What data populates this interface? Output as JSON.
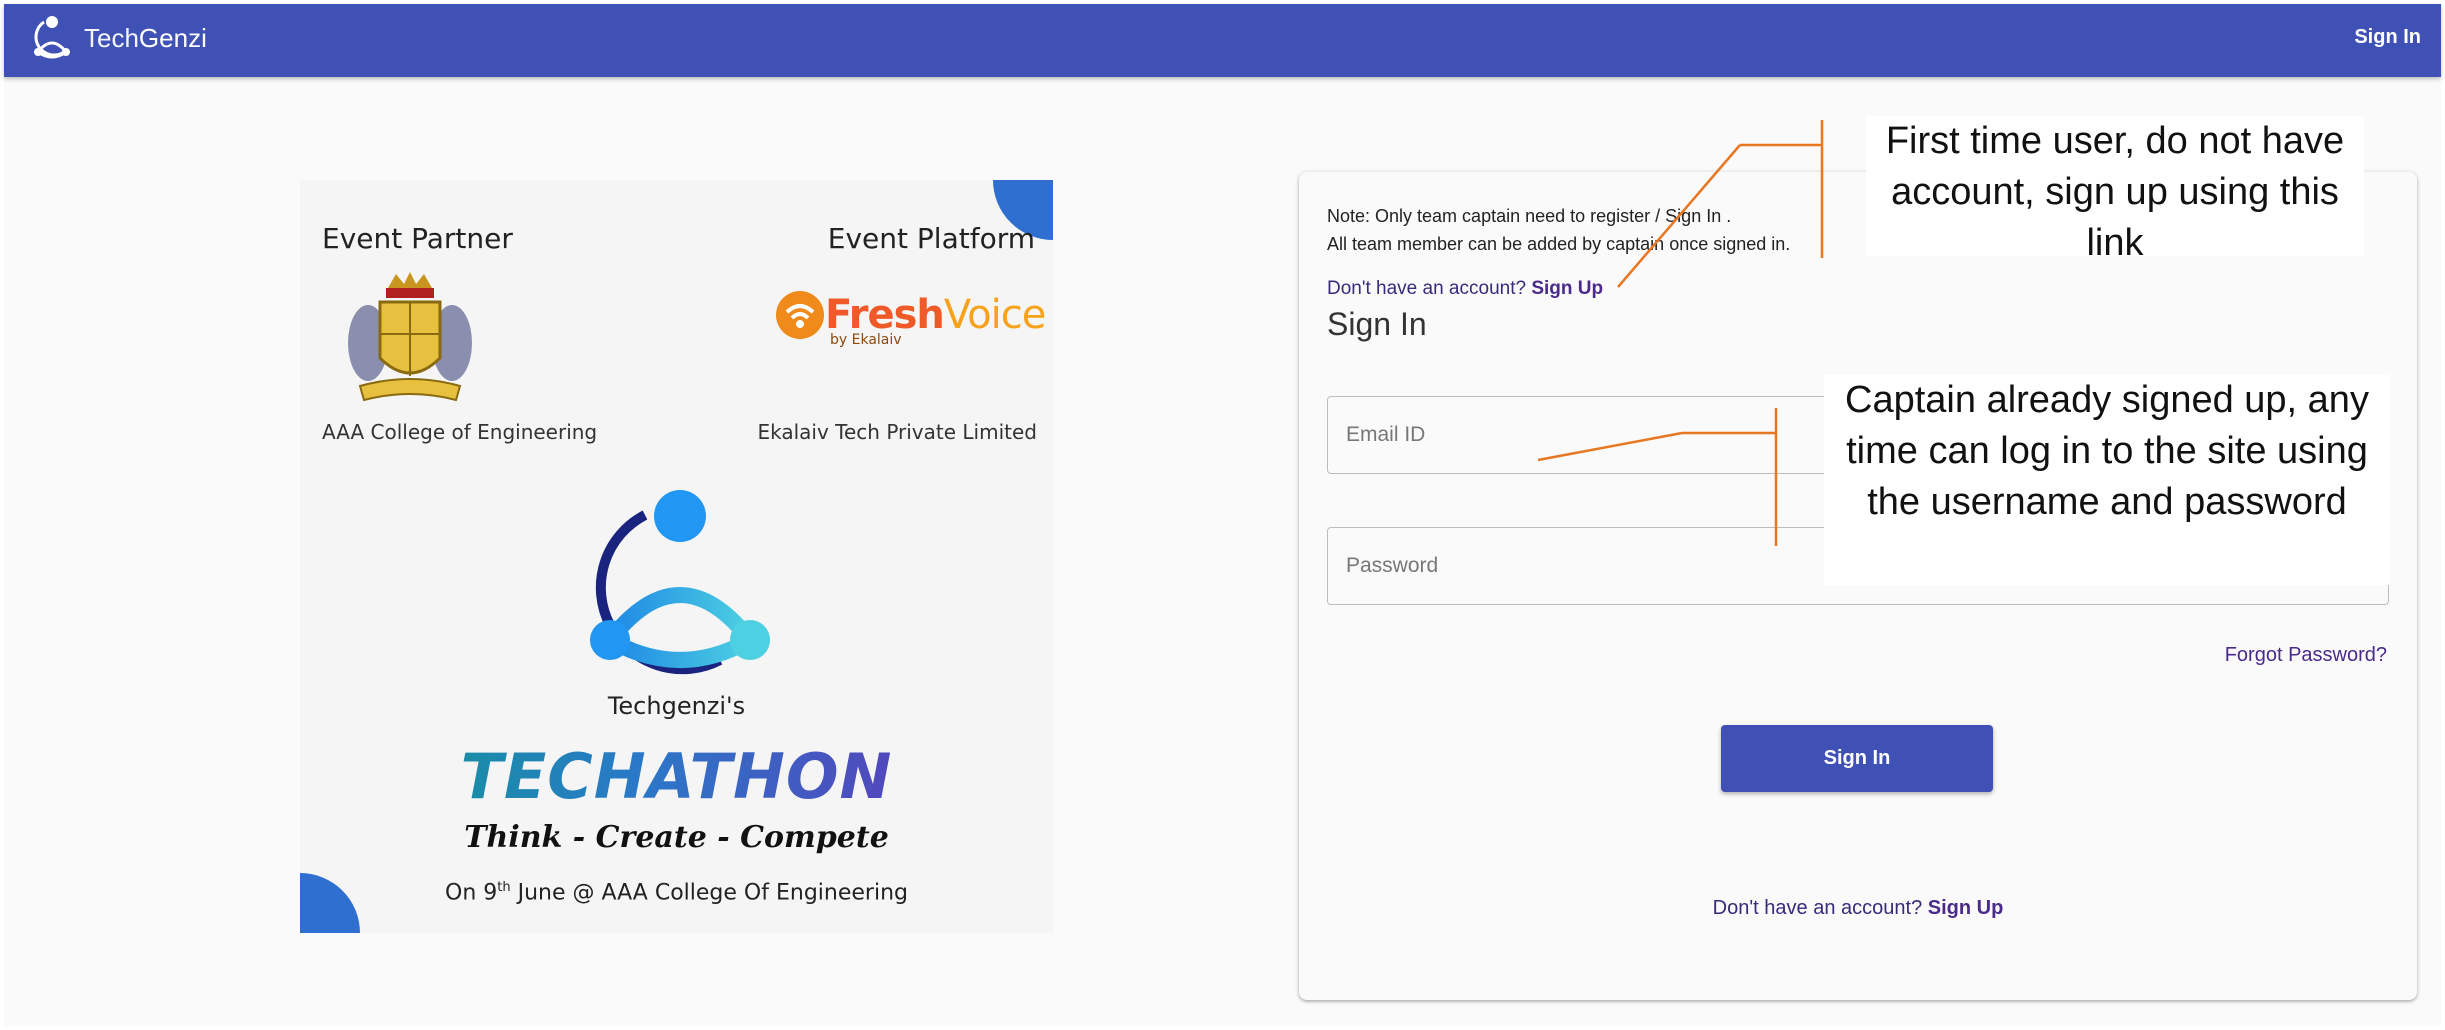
{
  "header": {
    "brand_tech": "Tech",
    "brand_genzi": "Genzi",
    "signin_label": "Sign In",
    "color": "#3f51b5"
  },
  "poster": {
    "event_partner": "Event Partner",
    "event_platform": "Event Platform",
    "partner_name": "AAA College of Engineering",
    "platform_name": "Ekalaiv Tech Private Limited",
    "fv_fresh": "Fresh",
    "fv_voice": "Voice",
    "fv_by": "by Ekalaiv",
    "techgenzi": "Techgenzi's",
    "techathon": "TECHATHON",
    "tagline": "Think - Create - Compete",
    "date_on": "On 9",
    "date_sup": "th",
    "date_rest": " June @ AAA College Of Engineering"
  },
  "form": {
    "note_line1": "Note: Only team captain need to register / Sign In .",
    "note_line2": "All team member can be added by captain once signed in.",
    "no_account": "Don't have an account?",
    "signup_link": "Sign Up",
    "title": "Sign In",
    "email_placeholder": "Email ID",
    "password_placeholder": "Password",
    "forgot": "Forgot Password?",
    "signin_button": "Sign In"
  },
  "callouts": {
    "first_time": "First time user, do not have account, sign up using this link",
    "captain": "Captain already signed up, any time can log in to the site using the username and password"
  }
}
